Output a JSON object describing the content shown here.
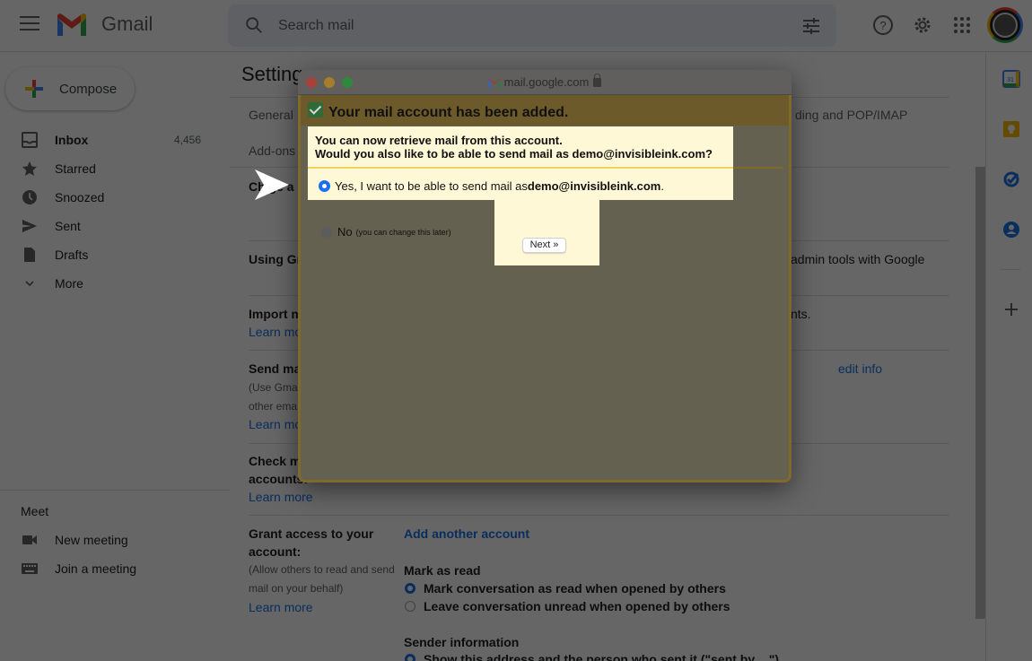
{
  "header": {
    "app_name": "Gmail",
    "search_placeholder": "Search mail",
    "icons": [
      "menu-icon",
      "search-icon",
      "tune-icon",
      "help-icon",
      "settings-icon",
      "apps-icon",
      "avatar"
    ]
  },
  "sidebar": {
    "compose_label": "Compose",
    "items": [
      {
        "label": "Inbox",
        "count": "4,456",
        "icon": "inbox-icon"
      },
      {
        "label": "Starred",
        "icon": "star-icon"
      },
      {
        "label": "Snoozed",
        "icon": "clock-icon"
      },
      {
        "label": "Sent",
        "icon": "send-icon"
      },
      {
        "label": "Drafts",
        "icon": "draft-icon"
      },
      {
        "label": "More",
        "icon": "chevron-down-icon"
      }
    ],
    "meet": {
      "title": "Meet",
      "items": [
        {
          "label": "New meeting",
          "icon": "video-icon"
        },
        {
          "label": "Join a meeting",
          "icon": "keyboard-icon"
        }
      ]
    }
  },
  "settings": {
    "title": "Setting",
    "tabs": {
      "general": "General",
      "forwarding": "ding and POP/IMAP",
      "addons": "Add-ons"
    },
    "rows": {
      "change": {
        "title": "Ch    ge a"
      },
      "using": {
        "title": "Using Gr",
        "right": "admin tools with Google"
      },
      "import": {
        "title": "Import m",
        "link": "Learn mo",
        "right": "nts."
      },
      "send": {
        "title": "Send ma",
        "desc1": "(Use Gma",
        "desc2": "other ema",
        "link": "Learn mo",
        "right_link": "edit info"
      },
      "check": {
        "title1": "Check m",
        "title2": "accounts:",
        "link": "Learn more"
      },
      "grant": {
        "title1": "Grant access to your",
        "title2": "account:",
        "desc1": "(Allow others to read and send",
        "desc2": "mail on your behalf)",
        "link": "Learn more",
        "add_link": "Add another account",
        "mark_as_read_label": "Mark as read",
        "mark_options": [
          {
            "label": "Mark conversation as read when opened by others",
            "selected": true
          },
          {
            "label": "Leave conversation unread when opened by others",
            "selected": false
          }
        ],
        "sender_info_label": "Sender information",
        "sender_option": "Show this address and the person who sent it (\"sent by ...\")"
      }
    }
  },
  "popup": {
    "url": "mail.google.com",
    "heading": "Your mail account has been added.",
    "line1": "You can now retrieve mail from this account.",
    "line2": "Would you also like to be able to send mail as demo@invisibleink.com?",
    "yes_prefix": "Yes, I want to be able to send mail as ",
    "yes_email": "demo@invisibleink.com",
    "yes_suffix": ".",
    "yes_selected": true,
    "no_label": "No",
    "no_hint": "(you can change this later)",
    "next_label": "Next »"
  },
  "colors": {
    "accent": "#1a73e8",
    "highlight": "#fff8d6",
    "popup_header": "#f5d36a"
  }
}
